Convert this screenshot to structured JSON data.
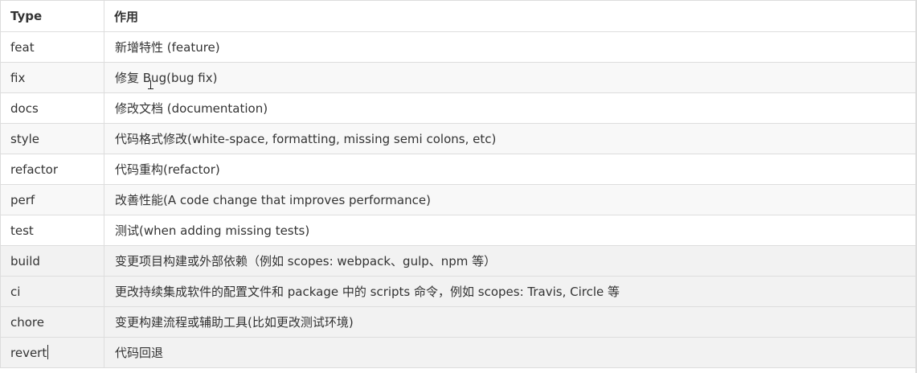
{
  "table": {
    "headers": {
      "type": "Type",
      "description": "作用"
    },
    "rows": [
      {
        "type": "feat",
        "description": "新增特性 (feature)"
      },
      {
        "type": "fix",
        "description": "修复 Bug(bug fix)"
      },
      {
        "type": "docs",
        "description": "修改文档 (documentation)"
      },
      {
        "type": "style",
        "description": "代码格式修改(white-space, formatting, missing semi colons, etc)"
      },
      {
        "type": "refactor",
        "description": "代码重构(refactor)"
      },
      {
        "type": "perf",
        "description": "改善性能(A code change that improves performance)"
      },
      {
        "type": "test",
        "description": "测试(when adding missing tests)"
      },
      {
        "type": "build",
        "description": "变更项目构建或外部依赖（例如 scopes: webpack、gulp、npm 等）"
      },
      {
        "type": "ci",
        "description": "更改持续集成软件的配置文件和 package 中的 scripts 命令，例如 scopes: Travis, Circle 等"
      },
      {
        "type": "chore",
        "description": "变更构建流程或辅助工具(比如更改测试环境)"
      },
      {
        "type": "revert",
        "description": "代码回退"
      }
    ]
  }
}
